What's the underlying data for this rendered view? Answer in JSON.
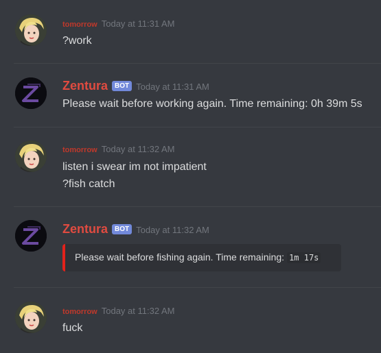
{
  "messages": [
    {
      "author": "tomorrow",
      "timestamp": "Today at 11:31 AM",
      "lines": [
        "?work"
      ]
    },
    {
      "author": "Zentura",
      "bot_tag": "BOT",
      "timestamp": "Today at 11:31 AM",
      "lines": [
        "Please wait before working again. Time remaining: 0h 39m 5s"
      ]
    },
    {
      "author": "tomorrow",
      "timestamp": "Today at 11:32 AM",
      "lines": [
        "listen i swear im not impatient",
        "?fish catch"
      ]
    },
    {
      "author": "Zentura",
      "bot_tag": "BOT",
      "timestamp": "Today at 11:32 AM",
      "embed": {
        "text": "Please wait before fishing again. Time remaining:",
        "code": "1m 17s",
        "accent": "#e3221b"
      }
    },
    {
      "author": "tomorrow",
      "timestamp": "Today at 11:32 AM",
      "lines": [
        "fuck"
      ]
    }
  ],
  "colors": {
    "background": "#36393f",
    "username_user": "#c0392b",
    "username_bot": "#e04b40",
    "bot_tag": "#7289da",
    "timestamp": "#72767d"
  }
}
